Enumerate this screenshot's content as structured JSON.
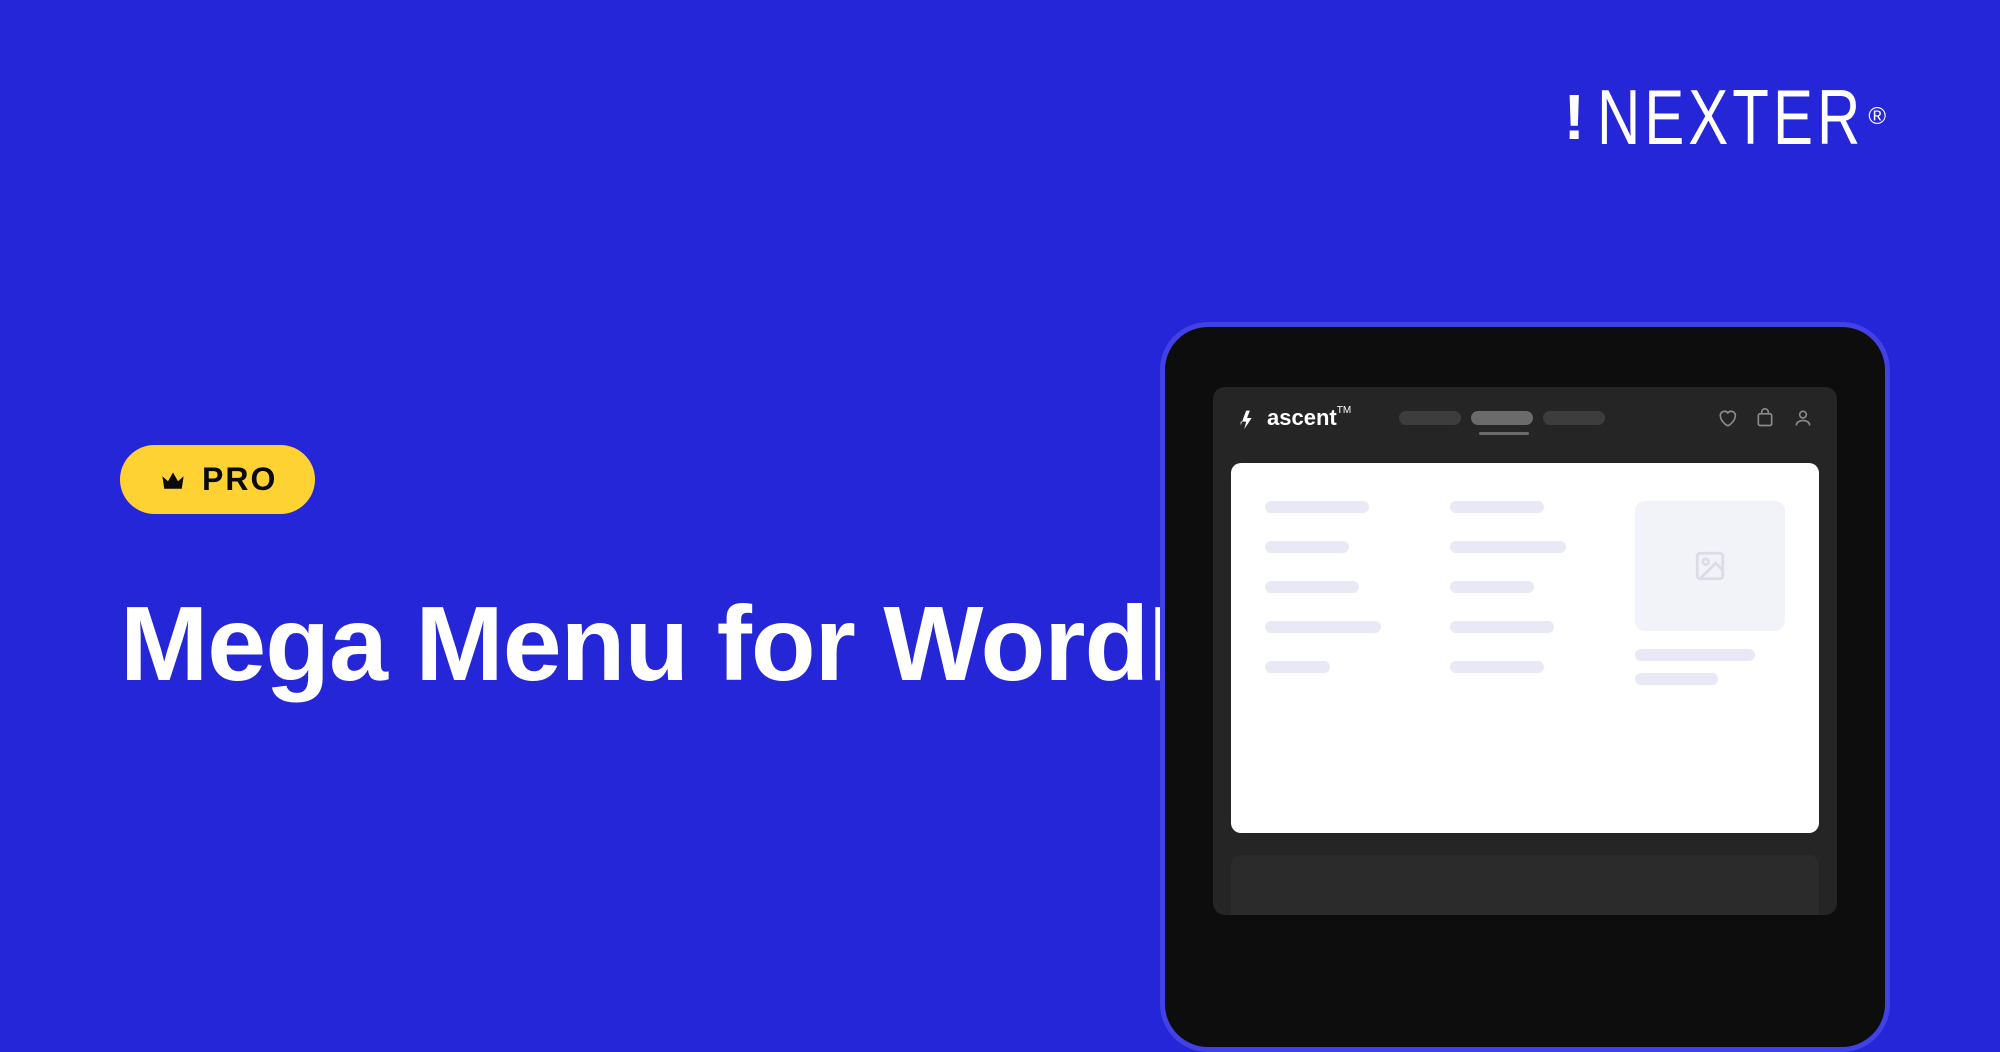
{
  "brand": {
    "name": "NEXTER"
  },
  "badge": {
    "label": "PRO"
  },
  "headline": {
    "text": "Mega Menu for WordPress"
  },
  "preview": {
    "app_name": "ascent",
    "app_suffix": "TM"
  }
}
